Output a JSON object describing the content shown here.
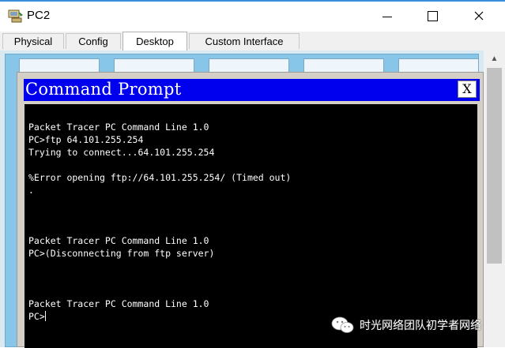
{
  "window": {
    "title": "PC2"
  },
  "tabs": [
    {
      "label": "Physical"
    },
    {
      "label": "Config"
    },
    {
      "label": "Desktop",
      "active": true
    },
    {
      "label": "Custom Interface"
    }
  ],
  "command_prompt": {
    "title": "Command Prompt",
    "close_label": "X",
    "lines": [
      "Packet Tracer PC Command Line 1.0",
      "PC>ftp 64.101.255.254",
      "Trying to connect...64.101.255.254",
      "",
      "%Error opening ftp://64.101.255.254/ (Timed out)",
      ".",
      "",
      "",
      "",
      "Packet Tracer PC Command Line 1.0",
      "PC>(Disconnecting from ftp server)",
      "",
      "",
      "",
      "Packet Tracer PC Command Line 1.0",
      "PC>"
    ]
  },
  "watermark": {
    "text": "时光网络团队初学者网络"
  },
  "colors": {
    "cmd_title_bg": "#0000ee",
    "console_bg": "#000000",
    "desktop_bg": "#87c6e8"
  }
}
